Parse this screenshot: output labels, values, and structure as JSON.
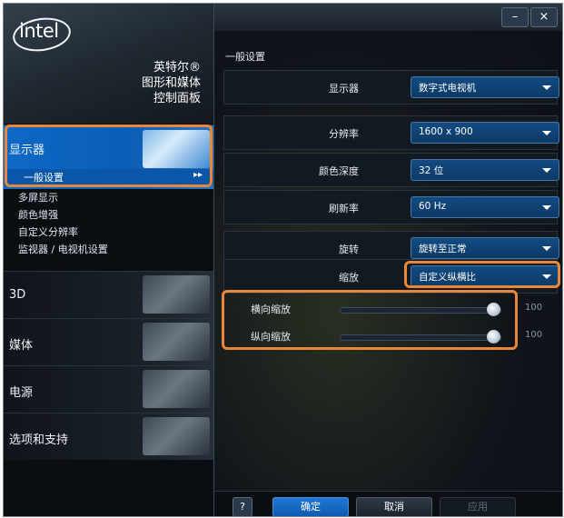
{
  "brand": {
    "logo": "intel",
    "line1": "英特尔®",
    "line2": "图形和媒体",
    "line3": "控制面板"
  },
  "nav": {
    "display": "显示器",
    "display_sub": {
      "selected": "一般设置",
      "items": [
        "多屏显示",
        "颜色增强",
        "自定义分辨率",
        "监视器 / 电视机设置"
      ]
    },
    "sections": [
      "3D",
      "媒体",
      "电源",
      "选项和支持"
    ]
  },
  "window": {
    "minimize": "–",
    "close": "×"
  },
  "main": {
    "section_title": "一般设置",
    "rows": [
      {
        "label": "显示器",
        "value": "数字式电视机"
      },
      {
        "label": "分辨率",
        "value": "1600 x 900"
      },
      {
        "label": "颜色深度",
        "value": "32 位"
      },
      {
        "label": "刷新率",
        "value": "60 Hz"
      },
      {
        "label": "旋转",
        "value": "旋转至正常"
      },
      {
        "label": "缩放",
        "value": "自定义纵横比"
      }
    ],
    "sliders": [
      {
        "label": "横向缩放",
        "value": "100",
        "level_percent": 100
      },
      {
        "label": "纵向缩放",
        "value": "100",
        "level_percent": 100
      }
    ]
  },
  "footer": {
    "help": "?",
    "ok": "确定",
    "cancel": "取消",
    "apply": "应用"
  },
  "colors": {
    "accent": "#0e69c6",
    "highlight": "#e8873a",
    "background": "#0b1016"
  }
}
